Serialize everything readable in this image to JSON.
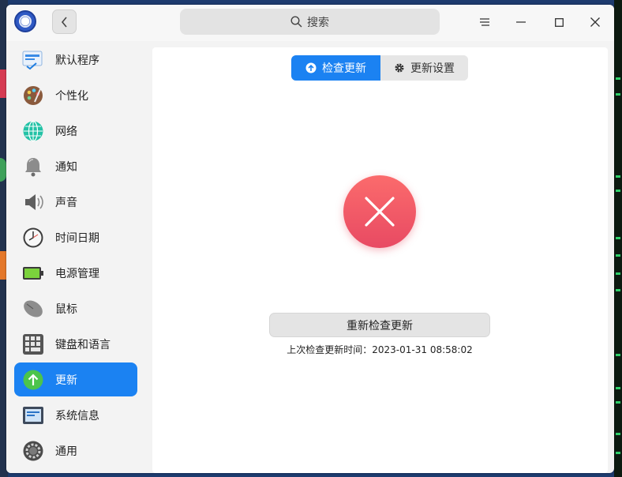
{
  "window": {
    "title": "",
    "back_label": "‹",
    "search_placeholder": "搜索",
    "accent": "#1b82f2",
    "error_color": "#f0566a"
  },
  "sidebar": {
    "items": [
      {
        "label": "默认程序",
        "icon": "default-apps-icon"
      },
      {
        "label": "个性化",
        "icon": "palette-icon"
      },
      {
        "label": "网络",
        "icon": "network-globe-icon"
      },
      {
        "label": "通知",
        "icon": "bell-icon"
      },
      {
        "label": "声音",
        "icon": "speaker-icon"
      },
      {
        "label": "时间日期",
        "icon": "clock-icon"
      },
      {
        "label": "电源管理",
        "icon": "battery-icon"
      },
      {
        "label": "鼠标",
        "icon": "mouse-icon"
      },
      {
        "label": "键盘和语言",
        "icon": "keyboard-icon"
      },
      {
        "label": "更新",
        "icon": "update-arrow-icon",
        "active": true
      },
      {
        "label": "系统信息",
        "icon": "system-info-icon"
      },
      {
        "label": "通用",
        "icon": "general-gear-icon"
      }
    ]
  },
  "main": {
    "tabs": [
      {
        "label": "检查更新",
        "icon": "arrow-up-circle-icon",
        "active": true
      },
      {
        "label": "更新设置",
        "icon": "gear-icon",
        "active": false
      }
    ],
    "status_icon": "error-x-icon",
    "recheck_button": "重新检查更新",
    "last_check_text": "上次检查更新时间：2023-01-31 08:58:02"
  }
}
